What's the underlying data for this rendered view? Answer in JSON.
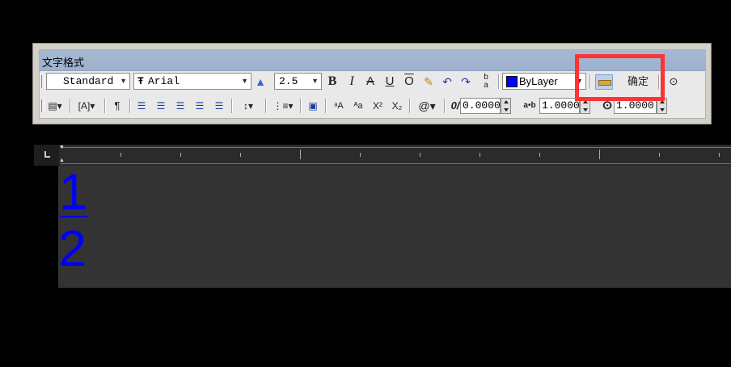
{
  "toolbar": {
    "title": "文字格式",
    "style": "Standard",
    "font": "Arial",
    "height": "2.5",
    "bold": "B",
    "italic": "I",
    "strike": "A",
    "underline": "U",
    "overline": "O",
    "color": "ByLayer",
    "color_swatch": "#0000ff",
    "ok_label": "确定",
    "oblique_value": "0.0000",
    "tracking_value": "1.0000",
    "width_value": "1.0000",
    "superscript": "X²",
    "subscript": "X₂",
    "symbol": "@"
  },
  "editor": {
    "numerator": "1",
    "denominator": "2",
    "text_color": "#0000ff"
  },
  "highlight_color": "#ff3333"
}
